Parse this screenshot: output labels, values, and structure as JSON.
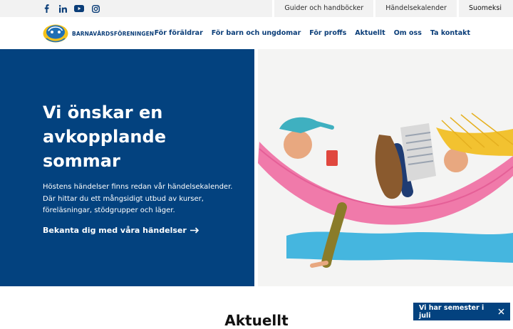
{
  "utility": {
    "social_icons": [
      "facebook-icon",
      "linkedin-icon",
      "youtube-icon",
      "instagram-icon"
    ],
    "links": [
      "Guider och handböcker",
      "Händelsekalender"
    ],
    "language": "Suomeksi"
  },
  "brand": {
    "logo_text": "BARNAVÅRDSFÖRENINGEN",
    "color_primary": "#03427f",
    "color_accent": "#f4c21b"
  },
  "nav": {
    "items": [
      "För föräldrar",
      "För barn och ungdomar",
      "För proffs",
      "Aktuellt",
      "Om oss",
      "Ta kontakt"
    ]
  },
  "hero": {
    "title": "Vi önskar en avkopplande sommar",
    "body": "Höstens händelser finns redan vår händelsekalender. Där hittar du ett mångsidigt utbud av kurser, föreläsningar, stödgrupper och läger.",
    "cta": "Bekanta dig med våra händelser",
    "cta_icon": "arrow-right-icon"
  },
  "section": {
    "heading": "Aktuellt"
  },
  "notice": {
    "text": "Vi har semester i juli",
    "close_icon": "close-icon"
  }
}
